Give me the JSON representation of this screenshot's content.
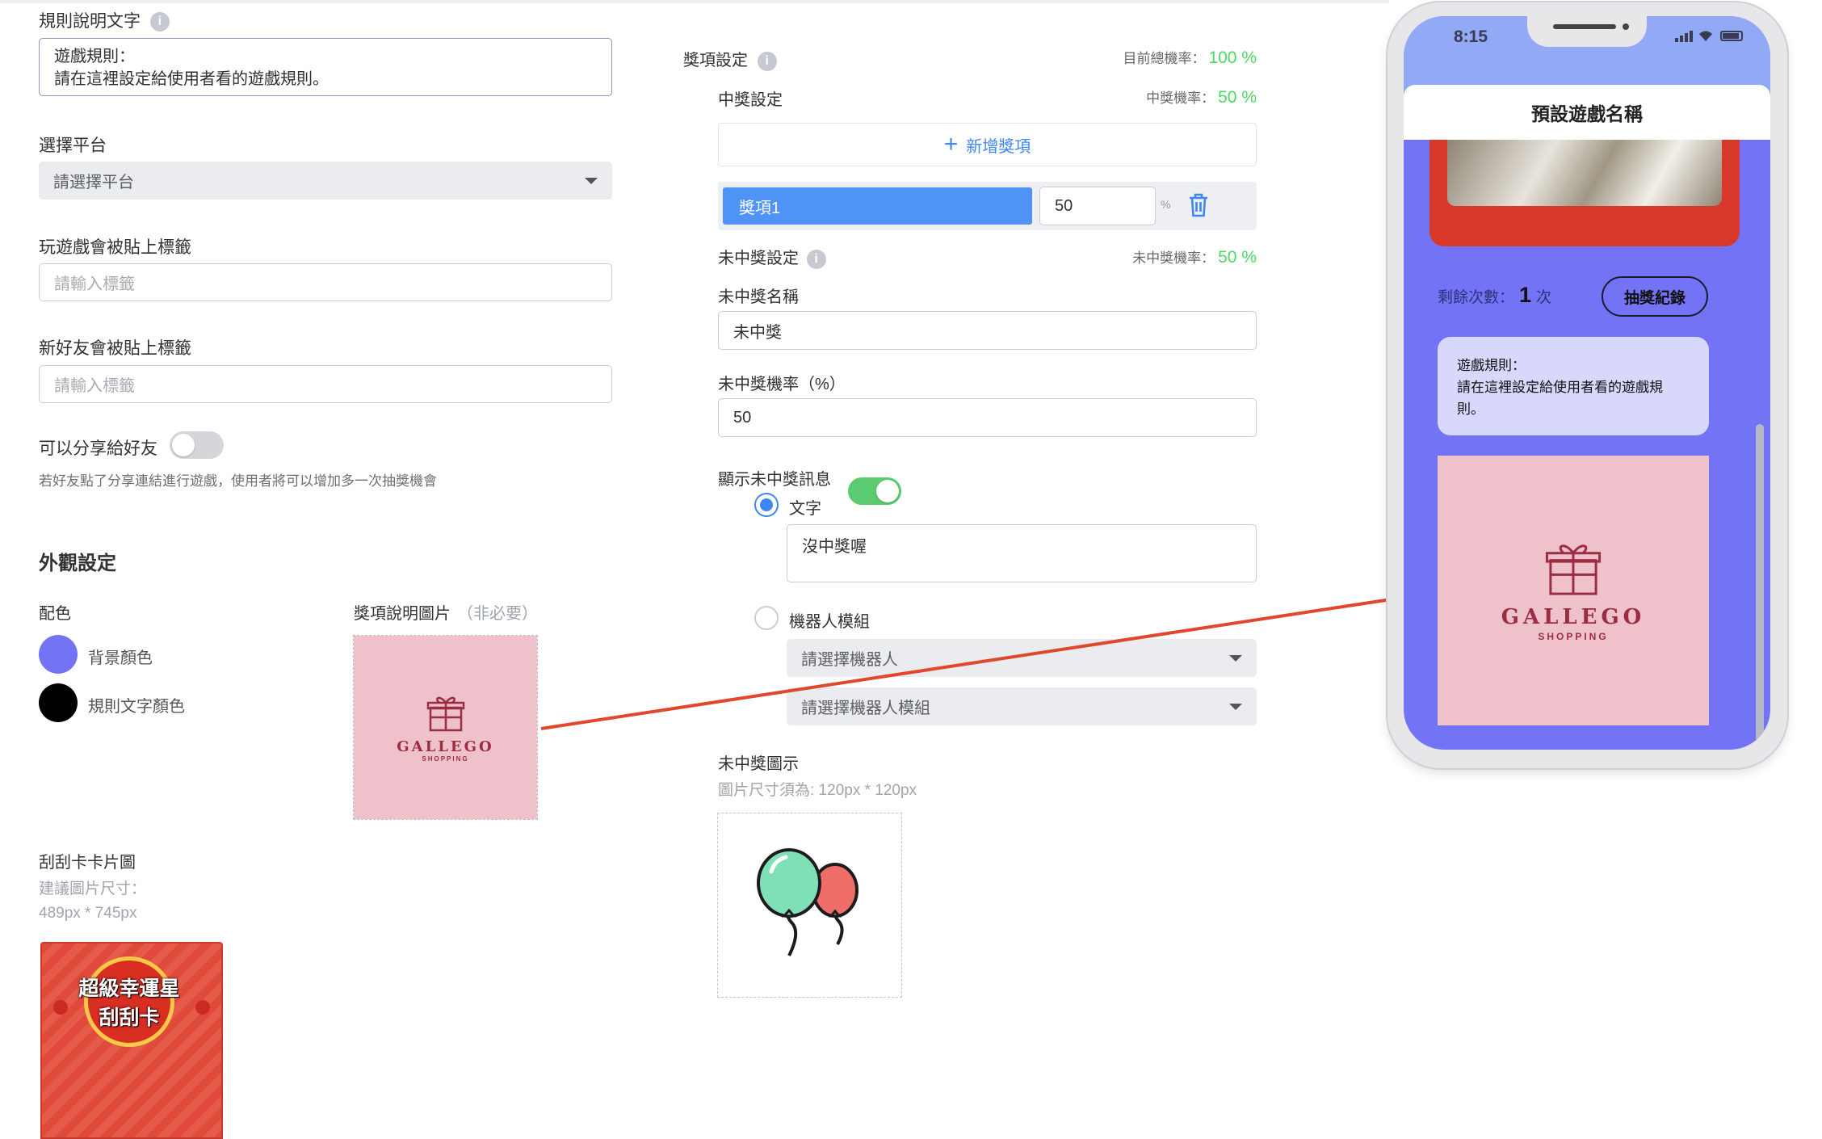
{
  "left": {
    "rules_label": "規則說明文字",
    "rules_line1": "遊戲規則：",
    "rules_line2": "請在這裡設定給使用者看的遊戲規則。",
    "platform_label": "選擇平台",
    "platform_placeholder": "請選擇平台",
    "play_tag_label": "玩遊戲會被貼上標籤",
    "play_tag_placeholder": "請輸入標籤",
    "friend_tag_label": "新好友會被貼上標籤",
    "friend_tag_placeholder": "請輸入標籤",
    "share_label": "可以分享給好友",
    "share_enabled": false,
    "share_hint": "若好友點了分享連結進行遊戲，使用者將可以增加多一次抽獎機會",
    "appearance_title": "外觀設定",
    "color_label": "配色",
    "bg_color_label": "背景顏色",
    "bg_color": "#7373f6",
    "rule_text_color_label": "規則文字顏色",
    "rule_text_color": "#000000",
    "prize_image_label": "獎項說明圖片",
    "prize_image_optional": "（非必要）",
    "scratch_label": "刮刮卡卡片圖",
    "scratch_hint1": "建議圖片尺寸：",
    "scratch_hint2": "489px * 745px",
    "scratch_card_line1": "超級幸運星",
    "scratch_card_line2": "刮刮卡"
  },
  "logo": {
    "name": "GALLEGO",
    "sub": "SHOPPING"
  },
  "mid": {
    "prize_settings_label": "獎項設定",
    "total_rate_label": "目前總機率：",
    "total_rate_value": "100 %",
    "win_settings_label": "中獎設定",
    "win_rate_label": "中獎機率：",
    "win_rate_value": "50 %",
    "add_prize_label": "新增獎項",
    "prize1_name": "獎項1",
    "prize1_value": "50",
    "percent": "%",
    "lose_settings_label": "未中獎設定",
    "lose_rate_label": "未中獎機率：",
    "lose_rate_value": "50 %",
    "lose_name_label": "未中獎名稱",
    "lose_name_value": "未中獎",
    "lose_rate_input_label": "未中獎機率（%）",
    "lose_rate_input_value": "50",
    "show_msg_label": "顯示未中獎訊息",
    "show_msg_enabled": true,
    "radio_text_label": "文字",
    "text_msg_value": "沒中獎喔",
    "radio_bot_label": "機器人模組",
    "bot_placeholder": "請選擇機器人",
    "bot_module_placeholder": "請選擇機器人模組",
    "lose_icon_label": "未中獎圖示",
    "lose_icon_hint": "圖片尺寸須為: 120px * 120px"
  },
  "phone": {
    "time": "8:15",
    "game_title": "預設遊戲名稱",
    "remaining_label": "剩餘次數：",
    "remaining_value": "1",
    "remaining_unit": "次",
    "history_button": "抽獎紀錄",
    "rules_line1": "遊戲規則：",
    "rules_line2": "請在這裡設定給使用者看的遊戲規",
    "rules_line3": "則。"
  }
}
